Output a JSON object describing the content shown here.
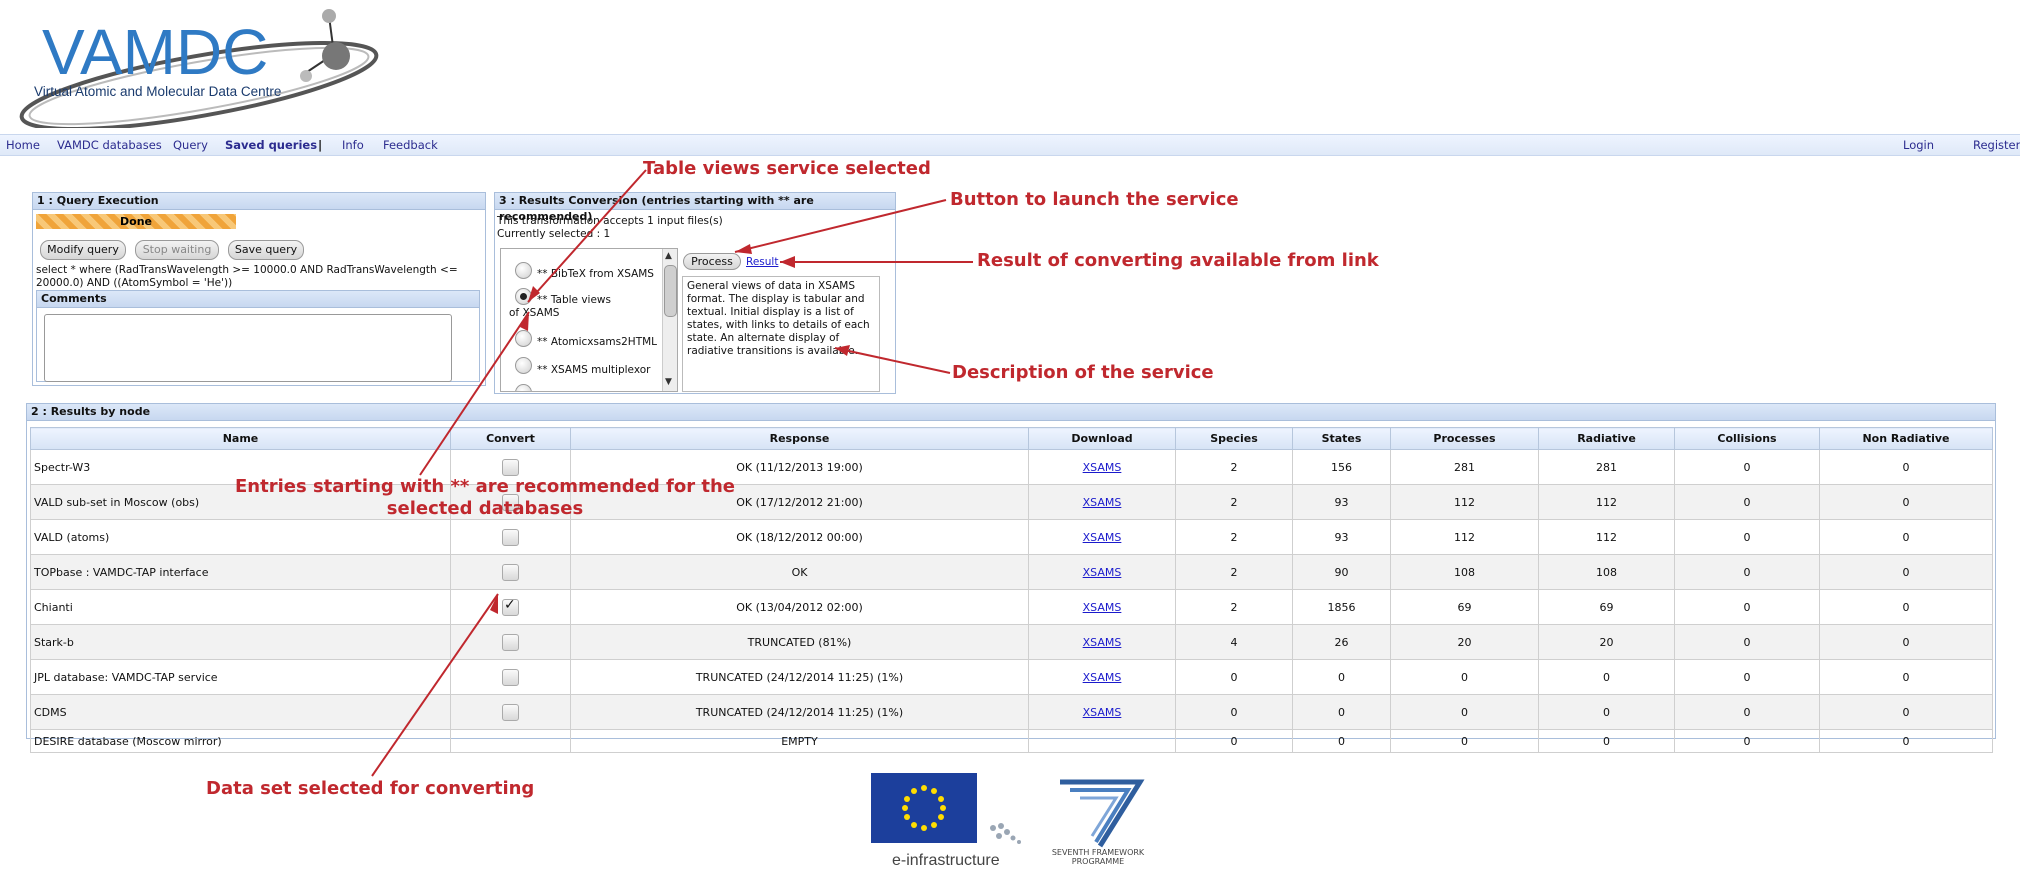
{
  "logo": {
    "name": "VAMDC",
    "tagline": "Virtual Atomic and Molecular Data Centre"
  },
  "nav": {
    "home": "Home",
    "vamdc_databases": "VAMDC databases",
    "query": "Query",
    "saved_queries": "Saved queries",
    "sep": "|",
    "info": "Info",
    "feedback": "Feedback",
    "login": "Login",
    "register": "Register"
  },
  "query_panel": {
    "title": "1 : Query Execution",
    "status": "Done",
    "modify": "Modify query",
    "stop": "Stop waiting",
    "save": "Save query",
    "query_text": "select * where (RadTransWavelength >= 10000.0 AND RadTransWavelength <= 20000.0) AND ((AtomSymbol = 'He'))",
    "comments_title": "Comments"
  },
  "conversion_panel": {
    "title": "3 : Results Conversion (entries starting with ** are recommended)",
    "accepts": "This transformation accepts 1 input files(s)",
    "selected": "Currently selected : 1",
    "options": [
      "** BibTeX from XSAMS",
      "** Table views of XSAMS",
      "** Atomicxsams2HTML",
      "** XSAMS multiplexor"
    ],
    "process": "Process",
    "result": "Result",
    "description": "General views of data in XSAMS format. The display is tabular and textual. Initial display is a list of states, with links to details of each state. An alternate display of radiative transitions is available."
  },
  "results_panel": {
    "title": "2 : Results by node",
    "columns": [
      "Name",
      "Convert",
      "Response",
      "Download",
      "Species",
      "States",
      "Processes",
      "Radiative",
      "Collisions",
      "Non Radiative"
    ],
    "rows": [
      {
        "name": "Spectr-W3",
        "response": "OK (11/12/2013 19:00)",
        "download": "XSAMS",
        "species": "2",
        "states": "156",
        "processes": "281",
        "radiative": "281",
        "collisions": "0",
        "nonrad": "0"
      },
      {
        "name": "VALD sub-set in Moscow (obs)",
        "response": "OK (17/12/2012 21:00)",
        "download": "XSAMS",
        "species": "2",
        "states": "93",
        "processes": "112",
        "radiative": "112",
        "collisions": "0",
        "nonrad": "0"
      },
      {
        "name": "VALD (atoms)",
        "response": "OK (18/12/2012 00:00)",
        "download": "XSAMS",
        "species": "2",
        "states": "93",
        "processes": "112",
        "radiative": "112",
        "collisions": "0",
        "nonrad": "0"
      },
      {
        "name": "TOPbase : VAMDC-TAP interface",
        "response": "OK",
        "download": "XSAMS",
        "species": "2",
        "states": "90",
        "processes": "108",
        "radiative": "108",
        "collisions": "0",
        "nonrad": "0"
      },
      {
        "name": "Chianti",
        "response": "OK (13/04/2012 02:00)",
        "download": "XSAMS",
        "species": "2",
        "states": "1856",
        "processes": "69",
        "radiative": "69",
        "collisions": "0",
        "nonrad": "0"
      },
      {
        "name": "Stark-b",
        "response": "TRUNCATED (81%)",
        "download": "XSAMS",
        "species": "4",
        "states": "26",
        "processes": "20",
        "radiative": "20",
        "collisions": "0",
        "nonrad": "0"
      },
      {
        "name": "JPL database: VAMDC-TAP service",
        "response": "TRUNCATED (24/12/2014 11:25) (1%)",
        "download": "XSAMS",
        "species": "0",
        "states": "0",
        "processes": "0",
        "radiative": "0",
        "collisions": "0",
        "nonrad": "0"
      },
      {
        "name": "CDMS",
        "response": "TRUNCATED (24/12/2014 11:25) (1%)",
        "download": "XSAMS",
        "species": "0",
        "states": "0",
        "processes": "0",
        "radiative": "0",
        "collisions": "0",
        "nonrad": "0"
      },
      {
        "name": "DESIRE database (Moscow mirror)",
        "response": "EMPTY",
        "download": "",
        "species": "0",
        "states": "0",
        "processes": "0",
        "radiative": "0",
        "collisions": "0",
        "nonrad": "0"
      }
    ]
  },
  "annotations": {
    "table_views": "Table views service selected",
    "launch": "Button to launch the service",
    "result_link": "Result of converting available from link",
    "description": "Description of the service",
    "recommended": "Entries starting with ** are recommended for the selected databases",
    "dataset": "Data set selected for converting"
  },
  "footer": {
    "einfra": "e-infrastructure",
    "fp7": "SEVENTH FRAMEWORK PROGRAMME"
  },
  "colors": {
    "annotation": "#c0282e",
    "nav_link": "#2c2c8f",
    "logo_blue": "#2f7ac4"
  },
  "icons": [
    "checkmark-icon",
    "eu-flag-icon",
    "fp7-logo-icon",
    "molecule-icon"
  ]
}
